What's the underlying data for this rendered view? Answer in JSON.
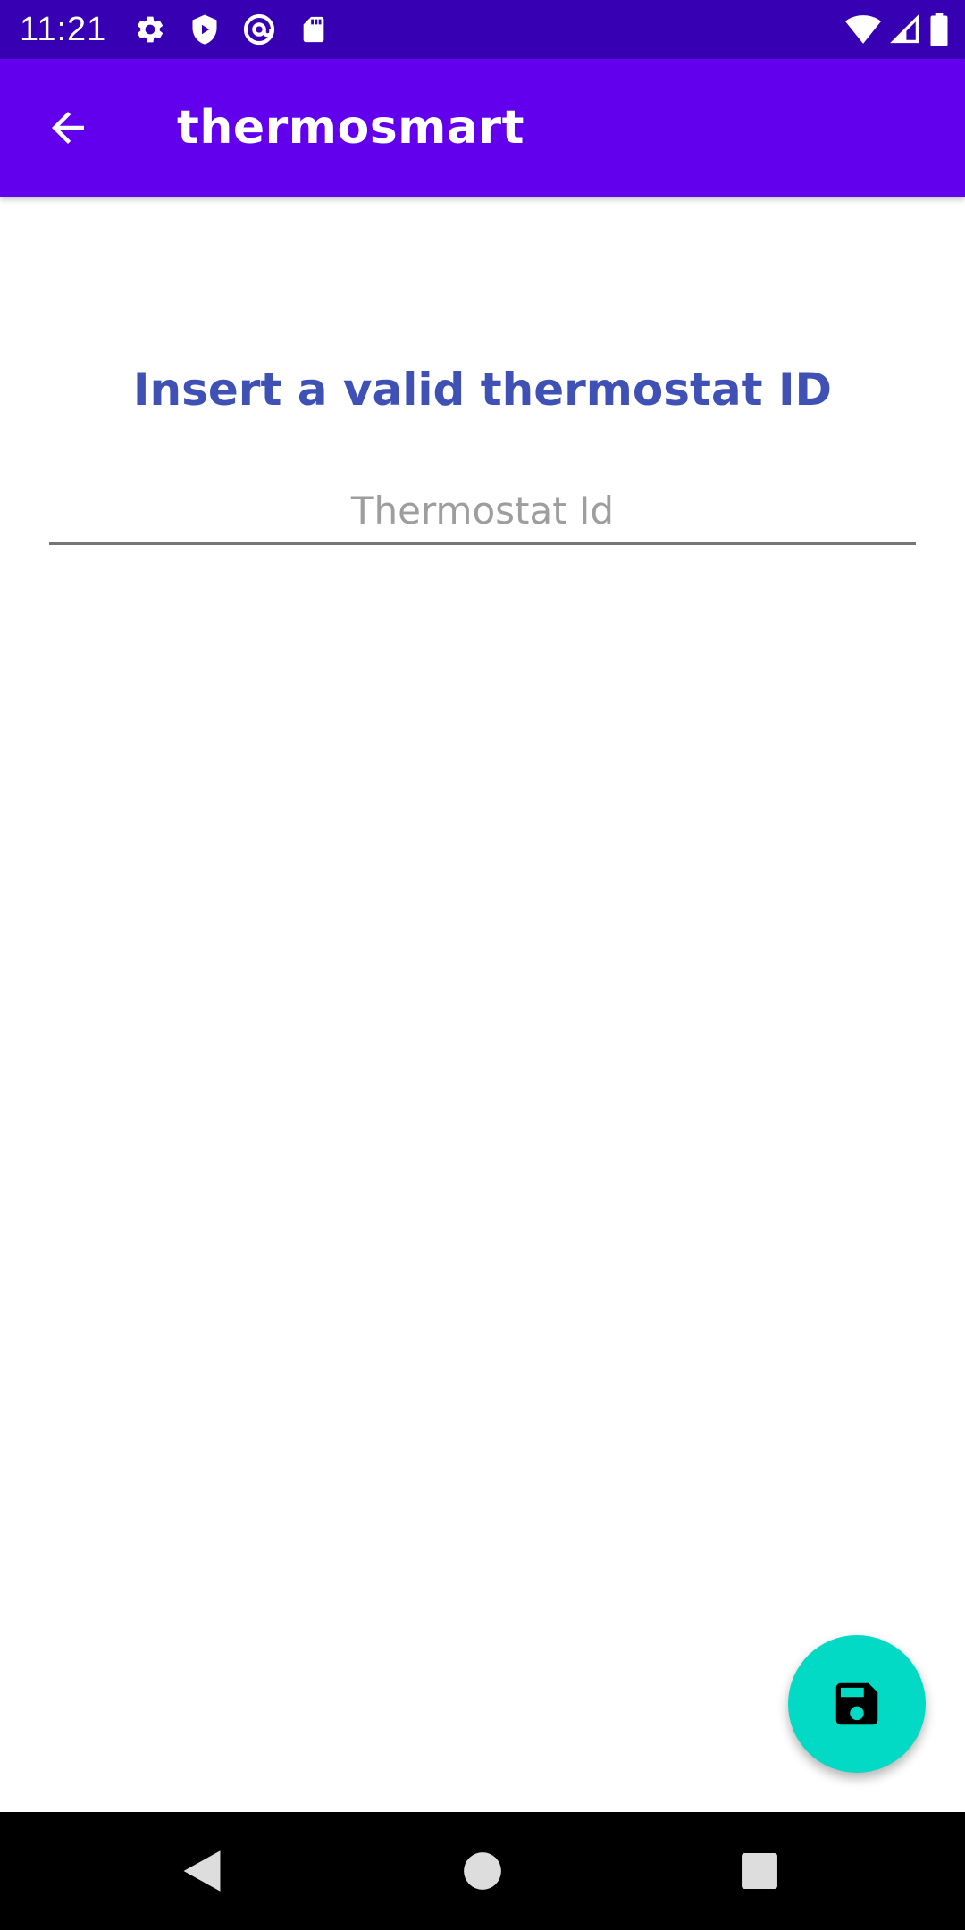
{
  "status_bar": {
    "time": "11:21",
    "left_icons": [
      "gear-icon",
      "shield-icon",
      "at-sign-icon",
      "sd-card-icon"
    ],
    "right_icons": [
      "wifi-icon",
      "cell-signal-icon",
      "battery-icon"
    ]
  },
  "app_bar": {
    "title": "thermosmart",
    "back_icon": "arrow-left-icon",
    "background": "#6200ee"
  },
  "content": {
    "heading": "Insert a valid thermostat ID",
    "heading_color": "#3f51b5",
    "thermostat_input": {
      "placeholder": "Thermostat Id",
      "value": ""
    }
  },
  "fab": {
    "icon": "floppy-disk-icon",
    "color": "#03dac5"
  },
  "nav_bar": {
    "buttons": [
      "back-triangle-icon",
      "home-circle-icon",
      "recents-square-icon"
    ]
  },
  "colors": {
    "status_bar": "#3700b3",
    "primary": "#6200ee",
    "accent": "#03dac5"
  }
}
